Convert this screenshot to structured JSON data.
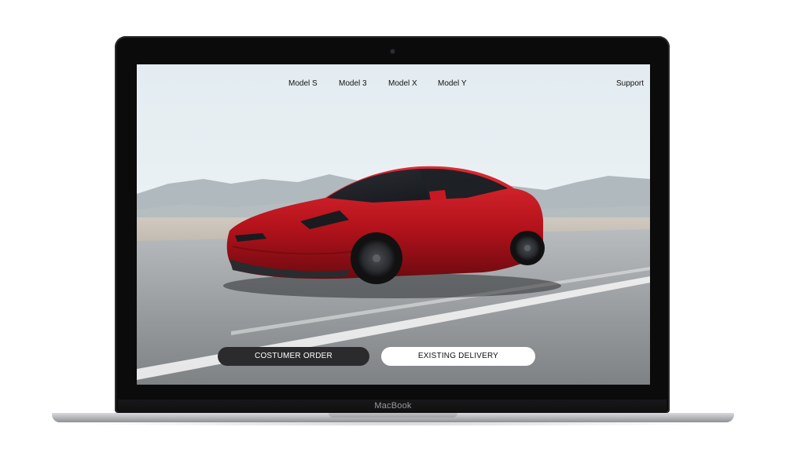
{
  "device": {
    "brand_label": "MacBook"
  },
  "nav": {
    "items": [
      {
        "label": "Model S"
      },
      {
        "label": "Model 3"
      },
      {
        "label": "Model X"
      },
      {
        "label": "Model Y"
      }
    ],
    "support_label": "Support"
  },
  "hero": {
    "image_description_icon": "red-sedan-car-image",
    "colors": {
      "car": "#b5121b",
      "sky": "#e7eef2",
      "road": "#8d9195",
      "mountain": "#a9b2b8"
    }
  },
  "actions": {
    "primary_label": "COSTUMER ORDER",
    "secondary_label": "EXISTING DELIVERY"
  }
}
